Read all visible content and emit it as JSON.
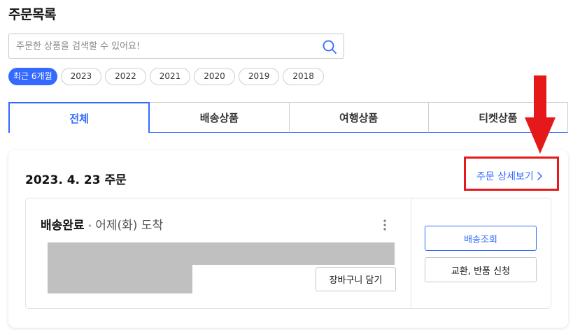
{
  "page": {
    "title": "주문목록"
  },
  "search": {
    "placeholder": "주문한 상품을 검색할 수 있어요!",
    "icon": "search-icon"
  },
  "period_filters": [
    {
      "label": "최근 6개월",
      "selected": true
    },
    {
      "label": "2023",
      "selected": false
    },
    {
      "label": "2022",
      "selected": false
    },
    {
      "label": "2021",
      "selected": false
    },
    {
      "label": "2020",
      "selected": false
    },
    {
      "label": "2019",
      "selected": false
    },
    {
      "label": "2018",
      "selected": false
    }
  ],
  "tabs": [
    {
      "label": "전체",
      "active": true
    },
    {
      "label": "배송상품",
      "active": false
    },
    {
      "label": "여행상품",
      "active": false
    },
    {
      "label": "티켓상품",
      "active": false
    }
  ],
  "order": {
    "date": "2023. 4. 23 주문",
    "detail_link": "주문 상세보기",
    "status": "배송완료",
    "separator": "•",
    "delivery": "어제(화) 도착",
    "cart_button": "장바구니 담기",
    "track_button": "배송조회",
    "return_button": "교환, 반품 신청"
  },
  "colors": {
    "accent": "#346aff",
    "annotation": "#e51919",
    "redaction": "#c0c0c0"
  }
}
